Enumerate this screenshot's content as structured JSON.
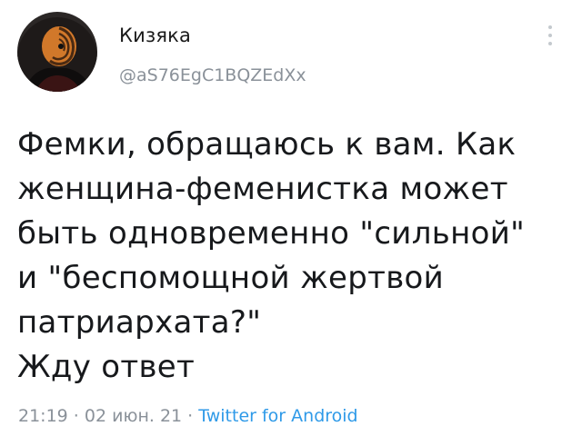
{
  "author": {
    "display_name": "Кизяка",
    "handle": "@aS76EgC1BQZEdXx",
    "avatar_icon": "masked-character-avatar"
  },
  "menu": {
    "icon": "more-vertical-icon"
  },
  "tweet": {
    "lines": [
      "Фемки, обращаюсь к вам. Как",
      "женщина-феменистка может",
      "быть одновременно \"сильной\"",
      "и \"беспомощной жертвой",
      "патриархата?\"",
      "Жду ответ"
    ]
  },
  "meta": {
    "time": "21:19",
    "separator": " · ",
    "date": "02 июн. 21",
    "source": "Twitter for Android"
  },
  "colors": {
    "link": "#2f9ae8",
    "secondary_text": "#8a9199",
    "primary_text": "#17191c"
  }
}
